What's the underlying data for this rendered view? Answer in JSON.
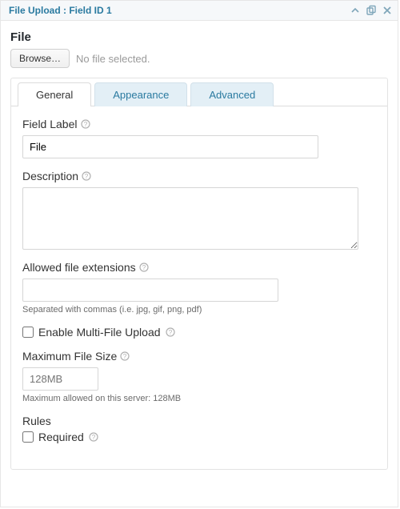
{
  "header": {
    "title": "File Upload : Field ID 1"
  },
  "preview": {
    "label": "File",
    "browse": "Browse…",
    "no_file": "No file selected."
  },
  "tabs": {
    "general": "General",
    "appearance": "Appearance",
    "advanced": "Advanced"
  },
  "general": {
    "field_label": {
      "label": "Field Label",
      "value": "File"
    },
    "description": {
      "label": "Description",
      "value": ""
    },
    "extensions": {
      "label": "Allowed file extensions",
      "value": "",
      "hint": "Separated with commas (i.e. jpg, gif, png, pdf)"
    },
    "multi": {
      "label": "Enable Multi-File Upload"
    },
    "maxsize": {
      "label": "Maximum File Size",
      "placeholder": "128MB",
      "hint": "Maximum allowed on this server: 128MB"
    },
    "rules": {
      "heading": "Rules",
      "required": "Required"
    }
  }
}
